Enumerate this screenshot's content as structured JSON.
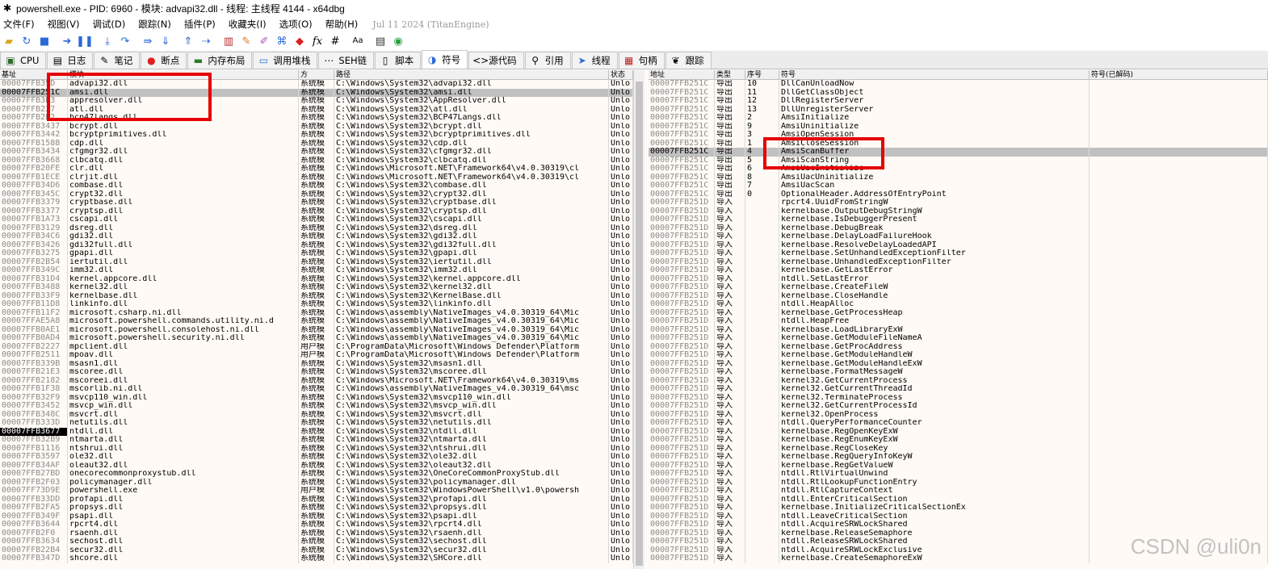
{
  "window": {
    "title": "powershell.exe - PID: 6960 - 模块: advapi32.dll - 线程: 主线程 4144 - x64dbg"
  },
  "menu": {
    "items": [
      "文件(F)",
      "视图(V)",
      "调试(D)",
      "跟踪(N)",
      "插件(P)",
      "收藏夹(I)",
      "选项(O)",
      "帮助(H)"
    ],
    "build_info": "Jul 11 2024 (TitanEngine)"
  },
  "toolbar": {
    "icons": [
      "open-icon",
      "restart-icon",
      "stop-icon",
      "run-icon",
      "pause-icon",
      "step-into-icon",
      "step-over-icon",
      "trace-into-icon",
      "trace-over-icon",
      "execute-till-return-icon",
      "run-to-user-code-icon",
      "patch-icon",
      "comment-icon",
      "label-icon",
      "bookmark-icon",
      "function-icon",
      "hash-icon",
      "font-icon",
      "calculator-icon",
      "favorites-icon"
    ]
  },
  "tabs": [
    {
      "label": "CPU",
      "icon": "cpu-icon"
    },
    {
      "label": "日志",
      "icon": "log-icon"
    },
    {
      "label": "笔记",
      "icon": "notes-icon"
    },
    {
      "label": "断点",
      "icon": "breakpoint-icon"
    },
    {
      "label": "内存布局",
      "icon": "memory-map-icon"
    },
    {
      "label": "调用堆栈",
      "icon": "call-stack-icon"
    },
    {
      "label": "SEH链",
      "icon": "seh-icon"
    },
    {
      "label": "脚本",
      "icon": "script-icon"
    },
    {
      "label": "符号",
      "icon": "symbols-icon",
      "active": true
    },
    {
      "label": "源代码",
      "icon": "source-icon"
    },
    {
      "label": "引用",
      "icon": "references-icon"
    },
    {
      "label": "线程",
      "icon": "threads-icon"
    },
    {
      "label": "句柄",
      "icon": "handles-icon"
    },
    {
      "label": "跟踪",
      "icon": "trace-icon"
    }
  ],
  "modules": {
    "headers": [
      "基址",
      "模块",
      "方",
      "路径",
      "状态"
    ],
    "rows": [
      [
        "00007FFB35D",
        "advapi32.dll",
        "系统模",
        "C:\\Windows\\System32\\advapi32.dll",
        "Unlo"
      ],
      [
        "00007FFB251C",
        "amsi.dll",
        "系统模",
        "C:\\Windows\\System32\\amsi.dll",
        "Unlo"
      ],
      [
        "00007FFB3E3",
        "appresolver.dll",
        "系统模",
        "C:\\Windows\\System32\\AppResolver.dll",
        "Unlo"
      ],
      [
        "00007FFB227",
        "atl.dll",
        "系统模",
        "C:\\Windows\\System32\\atl.dll",
        "Unlo"
      ],
      [
        "00007FFB2E2",
        "bcp47langs.dll",
        "系统模",
        "C:\\Windows\\System32\\BCP47Langs.dll",
        "Unlo"
      ],
      [
        "00007FFB3437",
        "bcrypt.dll",
        "系统模",
        "C:\\Windows\\System32\\bcrypt.dll",
        "Unlo"
      ],
      [
        "00007FFB3442",
        "bcryptprimitives.dll",
        "系统模",
        "C:\\Windows\\System32\\bcryptprimitives.dll",
        "Unlo"
      ],
      [
        "00007FFB1588",
        "cdp.dll",
        "系统模",
        "C:\\Windows\\System32\\cdp.dll",
        "Unlo"
      ],
      [
        "00007FFB3434",
        "cfgmgr32.dll",
        "系统模",
        "C:\\Windows\\System32\\cfgmgr32.dll",
        "Unlo"
      ],
      [
        "00007FFB3668",
        "clbcatq.dll",
        "系统模",
        "C:\\Windows\\System32\\clbcatq.dll",
        "Unlo"
      ],
      [
        "00007FFB20FE",
        "clr.dll",
        "系统模",
        "C:\\Windows\\Microsoft.NET\\Framework64\\v4.0.30319\\cl",
        "Unlo"
      ],
      [
        "00007FFB1ECE",
        "clrjit.dll",
        "系统模",
        "C:\\Windows\\Microsoft.NET\\Framework64\\v4.0.30319\\cl",
        "Unlo"
      ],
      [
        "00007FFB34D6",
        "combase.dll",
        "系统模",
        "C:\\Windows\\System32\\combase.dll",
        "Unlo"
      ],
      [
        "00007FFB345C",
        "crypt32.dll",
        "系统模",
        "C:\\Windows\\System32\\crypt32.dll",
        "Unlo"
      ],
      [
        "00007FFB3379",
        "cryptbase.dll",
        "系统模",
        "C:\\Windows\\System32\\cryptbase.dll",
        "Unlo"
      ],
      [
        "00007FFB3377",
        "cryptsp.dll",
        "系统模",
        "C:\\Windows\\System32\\cryptsp.dll",
        "Unlo"
      ],
      [
        "00007FFB1A73",
        "cscapi.dll",
        "系统模",
        "C:\\Windows\\System32\\cscapi.dll",
        "Unlo"
      ],
      [
        "00007FFB3129",
        "dsreg.dll",
        "系统模",
        "C:\\Windows\\System32\\dsreg.dll",
        "Unlo"
      ],
      [
        "00007FFB34C6",
        "gdi32.dll",
        "系统模",
        "C:\\Windows\\System32\\gdi32.dll",
        "Unlo"
      ],
      [
        "00007FFB3426",
        "gdi32full.dll",
        "系统模",
        "C:\\Windows\\System32\\gdi32full.dll",
        "Unlo"
      ],
      [
        "00007FFB3275",
        "gpapi.dll",
        "系统模",
        "C:\\Windows\\System32\\gpapi.dll",
        "Unlo"
      ],
      [
        "00007FFB2B54",
        "iertutil.dll",
        "系统模",
        "C:\\Windows\\System32\\iertutil.dll",
        "Unlo"
      ],
      [
        "00007FFB349C",
        "imm32.dll",
        "系统模",
        "C:\\Windows\\System32\\imm32.dll",
        "Unlo"
      ],
      [
        "00007FFB31D4",
        "kernel.appcore.dll",
        "系统模",
        "C:\\Windows\\System32\\kernel.appcore.dll",
        "Unlo"
      ],
      [
        "00007FFB3488",
        "kernel32.dll",
        "系统模",
        "C:\\Windows\\System32\\kernel32.dll",
        "Unlo"
      ],
      [
        "00007FFB33F9",
        "kernelbase.dll",
        "系统模",
        "C:\\Windows\\System32\\KernelBase.dll",
        "Unlo"
      ],
      [
        "00007FFB11D8",
        "linkinfo.dll",
        "系统模",
        "C:\\Windows\\System32\\linkinfo.dll",
        "Unlo"
      ],
      [
        "00007FFB11F2",
        "microsoft.csharp.ni.dll",
        "系统模",
        "C:\\Windows\\assembly\\NativeImages_v4.0.30319_64\\Mic",
        "Unlo"
      ],
      [
        "00007FFAE5A8",
        "microsoft.powershell.commands.utility.ni.d",
        "系统模",
        "C:\\Windows\\assembly\\NativeImages_v4.0.30319_64\\Mic",
        "Unlo"
      ],
      [
        "00007FFB0AE1",
        "microsoft.powershell.consolehost.ni.dll",
        "系统模",
        "C:\\Windows\\assembly\\NativeImages_v4.0.30319_64\\Mic",
        "Unlo"
      ],
      [
        "00007FFB0AD4",
        "microsoft.powershell.security.ni.dll",
        "系统模",
        "C:\\Windows\\assembly\\NativeImages_v4.0.30319_64\\Mic",
        "Unlo"
      ],
      [
        "00007FFB2227",
        "mpclient.dll",
        "用户模",
        "C:\\ProgramData\\Microsoft\\Windows Defender\\Platform",
        "Unlo"
      ],
      [
        "00007FFB2511",
        "mpoav.dll",
        "用户模",
        "C:\\ProgramData\\Microsoft\\Windows Defender\\Platform",
        "Unlo"
      ],
      [
        "00007FFB339B",
        "msasn1.dll",
        "系统模",
        "C:\\Windows\\System32\\msasn1.dll",
        "Unlo"
      ],
      [
        "00007FFB21E3",
        "mscoree.dll",
        "系统模",
        "C:\\Windows\\System32\\mscoree.dll",
        "Unlo"
      ],
      [
        "00007FFB2182",
        "mscoreei.dll",
        "系统模",
        "C:\\Windows\\Microsoft.NET\\Framework64\\v4.0.30319\\ms",
        "Unlo"
      ],
      [
        "00007FFB1F38",
        "mscorlib.ni.dll",
        "系统模",
        "C:\\Windows\\assembly\\NativeImages_v4.0.30319_64\\msc",
        "Unlo"
      ],
      [
        "00007FFB32F9",
        "msvcp110_win.dll",
        "系统模",
        "C:\\Windows\\System32\\msvcp110_win.dll",
        "Unlo"
      ],
      [
        "00007FFB3452",
        "msvcp_win.dll",
        "系统模",
        "C:\\Windows\\System32\\msvcp_win.dll",
        "Unlo"
      ],
      [
        "00007FFB348C",
        "msvcrt.dll",
        "系统模",
        "C:\\Windows\\System32\\msvcrt.dll",
        "Unlo"
      ],
      [
        "00007FFB333D",
        "netutils.dll",
        "系统模",
        "C:\\Windows\\System32\\netutils.dll",
        "Unlo"
      ],
      [
        "00007FFB3677",
        "ntdll.dll",
        "系统模",
        "C:\\Windows\\System32\\ntdll.dll",
        "Unlo"
      ],
      [
        "00007FFB32B9",
        "ntmarta.dll",
        "系统模",
        "C:\\Windows\\System32\\ntmarta.dll",
        "Unlo"
      ],
      [
        "00007FFB1116",
        "ntshrui.dll",
        "系统模",
        "C:\\Windows\\System32\\ntshrui.dll",
        "Unlo"
      ],
      [
        "00007FFB3597",
        "ole32.dll",
        "系统模",
        "C:\\Windows\\System32\\ole32.dll",
        "Unlo"
      ],
      [
        "00007FFB34AF",
        "oleaut32.dll",
        "系统模",
        "C:\\Windows\\System32\\oleaut32.dll",
        "Unlo"
      ],
      [
        "00007FFB27BD",
        "onecorecommonproxystub.dll",
        "系统模",
        "C:\\Windows\\System32\\OneCoreCommonProxyStub.dll",
        "Unlo"
      ],
      [
        "00007FFB2F03",
        "policymanager.dll",
        "系统模",
        "C:\\Windows\\System32\\policymanager.dll",
        "Unlo"
      ],
      [
        "00007FF73D9E",
        "powershell.exe",
        "用户模",
        "C:\\Windows\\System32\\WindowsPowerShell\\v1.0\\powersh",
        "Unlo"
      ],
      [
        "00007FFB33DD",
        "profapi.dll",
        "系统模",
        "C:\\Windows\\System32\\profapi.dll",
        "Unlo"
      ],
      [
        "00007FFB2FA5",
        "propsys.dll",
        "系统模",
        "C:\\Windows\\System32\\propsys.dll",
        "Unlo"
      ],
      [
        "00007FFB349F",
        "psapi.dll",
        "系统模",
        "C:\\Windows\\System32\\psapi.dll",
        "Unlo"
      ],
      [
        "00007FFB3644",
        "rpcrt4.dll",
        "系统模",
        "C:\\Windows\\System32\\rpcrt4.dll",
        "Unlo"
      ],
      [
        "00007FFB2F0",
        "rsaenh.dll",
        "系统模",
        "C:\\Windows\\System32\\rsaenh.dll",
        "Unlo"
      ],
      [
        "00007FFB3634",
        "sechost.dll",
        "系统模",
        "C:\\Windows\\System32\\sechost.dll",
        "Unlo"
      ],
      [
        "00007FFB22B4",
        "secur32.dll",
        "系统模",
        "C:\\Windows\\System32\\secur32.dll",
        "Unlo"
      ],
      [
        "00007FFB347D",
        "shcore.dll",
        "系统模",
        "C:\\Windows\\System32\\SHCore.dll",
        "Unlo"
      ]
    ],
    "selected_index": 1,
    "current_index": 41
  },
  "symbols": {
    "headers": [
      "地址",
      "类型",
      "序号",
      "符号",
      "符号(已解码)"
    ],
    "rows": [
      [
        "00007FFB251C",
        "导出",
        "10",
        "DllCanUnloadNow"
      ],
      [
        "00007FFB251C",
        "导出",
        "11",
        "DllGetClassObject"
      ],
      [
        "00007FFB251C",
        "导出",
        "12",
        "DllRegisterServer"
      ],
      [
        "00007FFB251C",
        "导出",
        "13",
        "DllUnregisterServer"
      ],
      [
        "00007FFB251C",
        "导出",
        "2",
        "AmsiInitialize"
      ],
      [
        "00007FFB251C",
        "导出",
        "9",
        "AmsiUninitialize"
      ],
      [
        "00007FFB251C",
        "导出",
        "3",
        "AmsiOpenSession"
      ],
      [
        "00007FFB251C",
        "导出",
        "1",
        "AmsiCloseSession"
      ],
      [
        "00007FFB251C",
        "导出",
        "4",
        "AmsiScanBuffer"
      ],
      [
        "00007FFB251C",
        "导出",
        "5",
        "AmsiScanString"
      ],
      [
        "00007FFB251C",
        "导出",
        "6",
        "AmsiUacInitialize"
      ],
      [
        "00007FFB251C",
        "导出",
        "8",
        "AmsiUacUninitialize"
      ],
      [
        "00007FFB251C",
        "导出",
        "7",
        "AmsiUacScan"
      ],
      [
        "00007FFB251C",
        "导出",
        "0",
        "OptionalHeader.AddressOfEntryPoint"
      ],
      [
        "00007FFB251D",
        "导入",
        "",
        "rpcrt4.UuidFromStringW"
      ],
      [
        "00007FFB251D",
        "导入",
        "",
        "kernelbase.OutputDebugStringW"
      ],
      [
        "00007FFB251D",
        "导入",
        "",
        "kernelbase.IsDebuggerPresent"
      ],
      [
        "00007FFB251D",
        "导入",
        "",
        "kernelbase.DebugBreak"
      ],
      [
        "00007FFB251D",
        "导入",
        "",
        "kernelbase.DelayLoadFailureHook"
      ],
      [
        "00007FFB251D",
        "导入",
        "",
        "kernelbase.ResolveDelayLoadedAPI"
      ],
      [
        "00007FFB251D",
        "导入",
        "",
        "kernelbase.SetUnhandledExceptionFilter"
      ],
      [
        "00007FFB251D",
        "导入",
        "",
        "kernelbase.UnhandledExceptionFilter"
      ],
      [
        "00007FFB251D",
        "导入",
        "",
        "kernelbase.GetLastError"
      ],
      [
        "00007FFB251D",
        "导入",
        "",
        "ntdll.SetLastError"
      ],
      [
        "00007FFB251D",
        "导入",
        "",
        "kernelbase.CreateFileW"
      ],
      [
        "00007FFB251D",
        "导入",
        "",
        "kernelbase.CloseHandle"
      ],
      [
        "00007FFB251D",
        "导入",
        "",
        "ntdll.HeapAlloc"
      ],
      [
        "00007FFB251D",
        "导入",
        "",
        "kernelbase.GetProcessHeap"
      ],
      [
        "00007FFB251D",
        "导入",
        "",
        "ntdll.HeapFree"
      ],
      [
        "00007FFB251D",
        "导入",
        "",
        "kernelbase.LoadLibraryExW"
      ],
      [
        "00007FFB251D",
        "导入",
        "",
        "kernelbase.GetModuleFileNameA"
      ],
      [
        "00007FFB251D",
        "导入",
        "",
        "kernelbase.GetProcAddress"
      ],
      [
        "00007FFB251D",
        "导入",
        "",
        "kernelbase.GetModuleHandleW"
      ],
      [
        "00007FFB251D",
        "导入",
        "",
        "kernelbase.GetModuleHandleExW"
      ],
      [
        "00007FFB251D",
        "导入",
        "",
        "kernelbase.FormatMessageW"
      ],
      [
        "00007FFB251D",
        "导入",
        "",
        "kernel32.GetCurrentProcess"
      ],
      [
        "00007FFB251D",
        "导入",
        "",
        "kernel32.GetCurrentThreadId"
      ],
      [
        "00007FFB251D",
        "导入",
        "",
        "kernel32.TerminateProcess"
      ],
      [
        "00007FFB251D",
        "导入",
        "",
        "kernel32.GetCurrentProcessId"
      ],
      [
        "00007FFB251D",
        "导入",
        "",
        "kernel32.OpenProcess"
      ],
      [
        "00007FFB251D",
        "导入",
        "",
        "ntdll.QueryPerformanceCounter"
      ],
      [
        "00007FFB251D",
        "导入",
        "",
        "kernelbase.RegOpenKeyExW"
      ],
      [
        "00007FFB251D",
        "导入",
        "",
        "kernelbase.RegEnumKeyExW"
      ],
      [
        "00007FFB251D",
        "导入",
        "",
        "kernelbase.RegCloseKey"
      ],
      [
        "00007FFB251D",
        "导入",
        "",
        "kernelbase.RegQueryInfoKeyW"
      ],
      [
        "00007FFB251D",
        "导入",
        "",
        "kernelbase.RegGetValueW"
      ],
      [
        "00007FFB251D",
        "导入",
        "",
        "ntdll.RtlVirtualUnwind"
      ],
      [
        "00007FFB251D",
        "导入",
        "",
        "ntdll.RtlLookupFunctionEntry"
      ],
      [
        "00007FFB251D",
        "导入",
        "",
        "ntdll.RtlCaptureContext"
      ],
      [
        "00007FFB251D",
        "导入",
        "",
        "ntdll.EnterCriticalSection"
      ],
      [
        "00007FFB251D",
        "导入",
        "",
        "kernelbase.InitializeCriticalSectionEx"
      ],
      [
        "00007FFB251D",
        "导入",
        "",
        "ntdll.LeaveCriticalSection"
      ],
      [
        "00007FFB251D",
        "导入",
        "",
        "ntdll.AcquireSRWLockShared"
      ],
      [
        "00007FFB251D",
        "导入",
        "",
        "kernelbase.ReleaseSemaphore"
      ],
      [
        "00007FFB251D",
        "导入",
        "",
        "ntdll.ReleaseSRWLockShared"
      ],
      [
        "00007FFB251D",
        "导入",
        "",
        "ntdll.AcquireSRWLockExclusive"
      ],
      [
        "00007FFB251D",
        "导入",
        "",
        "kernelbase.CreateSemaphoreExW"
      ]
    ],
    "selected_index": 8
  },
  "watermark": "CSDN @uli0n",
  "colors": {
    "highlight_box": "#e60000",
    "selected_row": "#c0c0c0",
    "pane_bg": "#fffaf5"
  }
}
